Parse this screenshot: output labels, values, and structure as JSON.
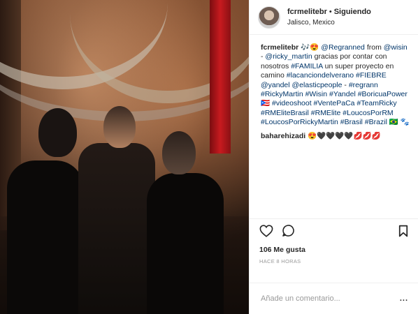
{
  "post": {
    "user": "fcrmelitebr",
    "separator": "•",
    "follow_status": "Siguiendo",
    "location": "Jalisco, Mexico"
  },
  "caption": {
    "user": "fcrmelitebr",
    "p1": "🎶😍 ",
    "m1": "@Regranned",
    "p2": " from ",
    "m2": "@wisin",
    "p3": " - ",
    "m3": "@ricky_martin",
    "p4": " gracias por contar con nosotros ",
    "m4": "#FAMILIA",
    "p5": " un super proyecto en camino ",
    "m5": "#lacanciondelverano #FIEBRE",
    "p6": " ",
    "m6": "@yandel @elasticpeople",
    "p7": " - ",
    "m7": "#regrann #RickyMartin #Wisin #Yandel #BoricuaPower",
    "p8": " 🇵🇷 ",
    "m8": "#videoshoot #VentePaCa #TeamRicky #RMEliteBrasil #RMElite #LoucosPorRM #LoucosPorRickyMartin #Brasil #Brazil",
    "p9": " 🇧🇷 🐾"
  },
  "comment2": {
    "user": "baharehizadi",
    "text": " 😍🖤🖤🖤🖤💋💋💋"
  },
  "actions": {
    "likes": "106 Me gusta",
    "time": "HACE 8 HORAS",
    "add_comment_placeholder": "Añade un comentario...",
    "more": "..."
  },
  "icons": {
    "like": "heart-icon",
    "comment": "comment-icon",
    "save": "bookmark-icon"
  }
}
